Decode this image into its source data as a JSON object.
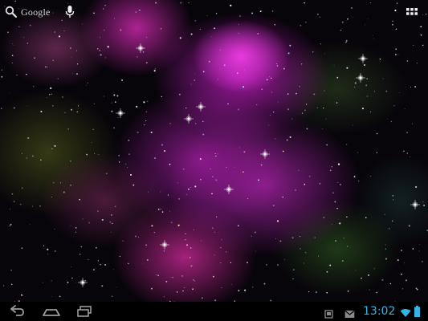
{
  "home": {
    "search": {
      "label": "Google",
      "icon": "search-icon"
    },
    "voice_icon": "microphone-icon",
    "apps_icon": "apps-grid-icon"
  },
  "navigation_bar": {
    "buttons": [
      "back-icon",
      "home-icon",
      "recent-apps-icon"
    ]
  },
  "status_bar": {
    "time": "13:02",
    "icons": [
      "screenshot-notification-icon",
      "gmail-notification-icon",
      "wifi-icon",
      "battery-icon"
    ],
    "accent_color": "#33b5e5"
  },
  "wallpaper": {
    "colors": [
      "#e43ce0",
      "#b41eb4",
      "#5a6e1e",
      "#07040a"
    ]
  }
}
